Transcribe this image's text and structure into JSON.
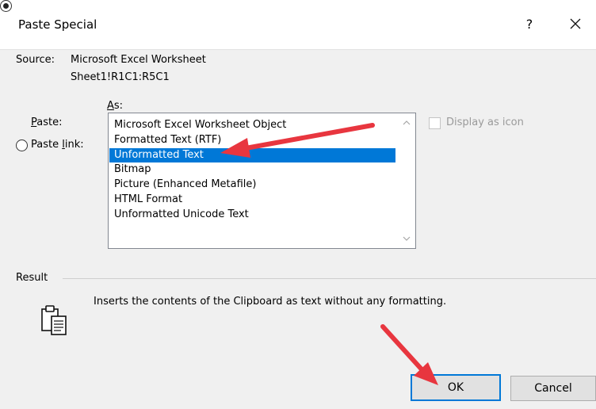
{
  "dialog": {
    "title": "Paste Special",
    "help_label": "?",
    "close_icon": "close-icon"
  },
  "source": {
    "label": "Source:",
    "value": "Microsoft Excel Worksheet",
    "range": "Sheet1!R1C1:R5C1"
  },
  "as_label": "As:",
  "paste_option": {
    "label_first": "P",
    "label_rest": "aste:",
    "checked": true
  },
  "paste_link_option": {
    "label_start": "Paste ",
    "label_ul": "l",
    "label_end": "ink:",
    "checked": false
  },
  "formats": [
    "Microsoft Excel Worksheet Object",
    "Formatted Text (RTF)",
    "Unformatted Text",
    "Bitmap",
    "Picture (Enhanced Metafile)",
    "HTML Format",
    "Unformatted Unicode Text"
  ],
  "selected_format": "Unformatted Text",
  "display_as_icon": {
    "label": "Display as icon",
    "checked": false,
    "enabled": false
  },
  "result": {
    "label": "Result",
    "text": "Inserts the contents of the Clipboard as text without any formatting.",
    "icon": "clipboard-icon"
  },
  "buttons": {
    "ok": "OK",
    "cancel": "Cancel"
  },
  "colors": {
    "selection": "#0078d7",
    "annotation_arrow": "#e8363f"
  }
}
